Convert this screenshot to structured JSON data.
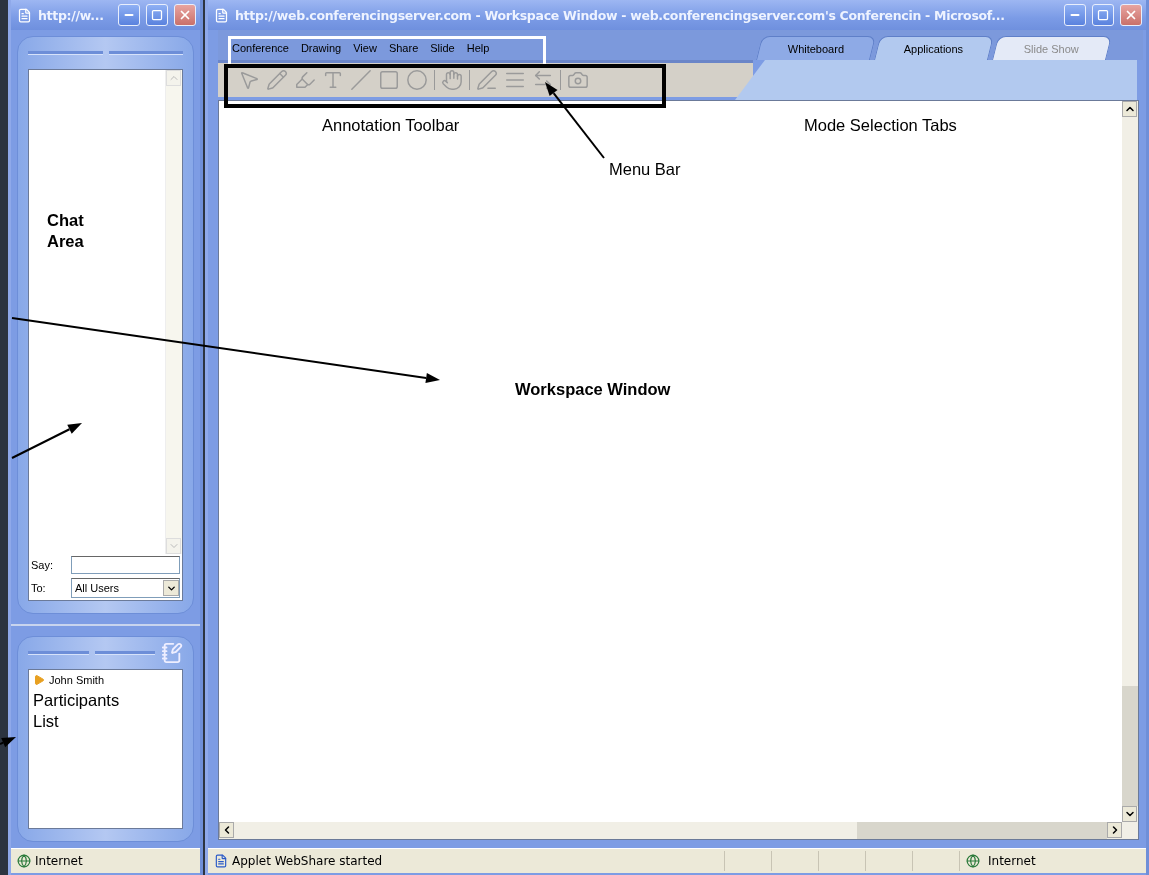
{
  "left_window": {
    "title": "http://w...",
    "chat": {
      "annotation": "Chat Area",
      "say_label": "Say:",
      "to_label": "To:",
      "to_value": "All Users"
    },
    "participants": {
      "items": [
        {
          "name": "John Smith"
        }
      ],
      "annotation": "Participants List"
    },
    "status_bar": {
      "zone": "Internet"
    }
  },
  "workspace_window": {
    "title": "http://web.conferencingserver.com - Workspace Window - web.conferencingserver.com's Conferencin - Microsof...",
    "menu": [
      "Conference",
      "Drawing",
      "View",
      "Share",
      "Slide",
      "Help"
    ],
    "toolbar": {
      "disabled": true
    },
    "tabs": [
      {
        "label": "Whiteboard",
        "selected": false,
        "disabled": false
      },
      {
        "label": "Applications",
        "selected": true,
        "disabled": false
      },
      {
        "label": "Slide Show",
        "selected": false,
        "disabled": true
      }
    ],
    "annotations": [
      {
        "kind": "label",
        "text": "Annotation Toolbar"
      },
      {
        "kind": "label",
        "text": "Mode Selection Tabs"
      },
      {
        "kind": "label",
        "text": "Menu Bar"
      },
      {
        "kind": "bold",
        "text": "Workspace Window"
      }
    ],
    "status_bar": {
      "message": "Applet WebShare started",
      "zone": "Internet"
    }
  }
}
